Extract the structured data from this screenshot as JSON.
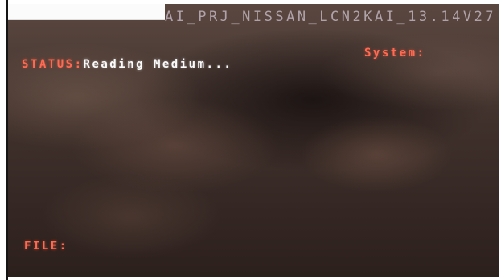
{
  "header": {
    "build_string": "AI_PRJ_NISSAN_LCN2KAI_13.14V27"
  },
  "status": {
    "label": "STATUS:",
    "value": "Reading Medium..."
  },
  "system": {
    "label": "System:"
  },
  "file": {
    "label": "FILE:"
  },
  "colors": {
    "label_accent": "#ff6a52",
    "value_text": "#fbfbfb"
  }
}
